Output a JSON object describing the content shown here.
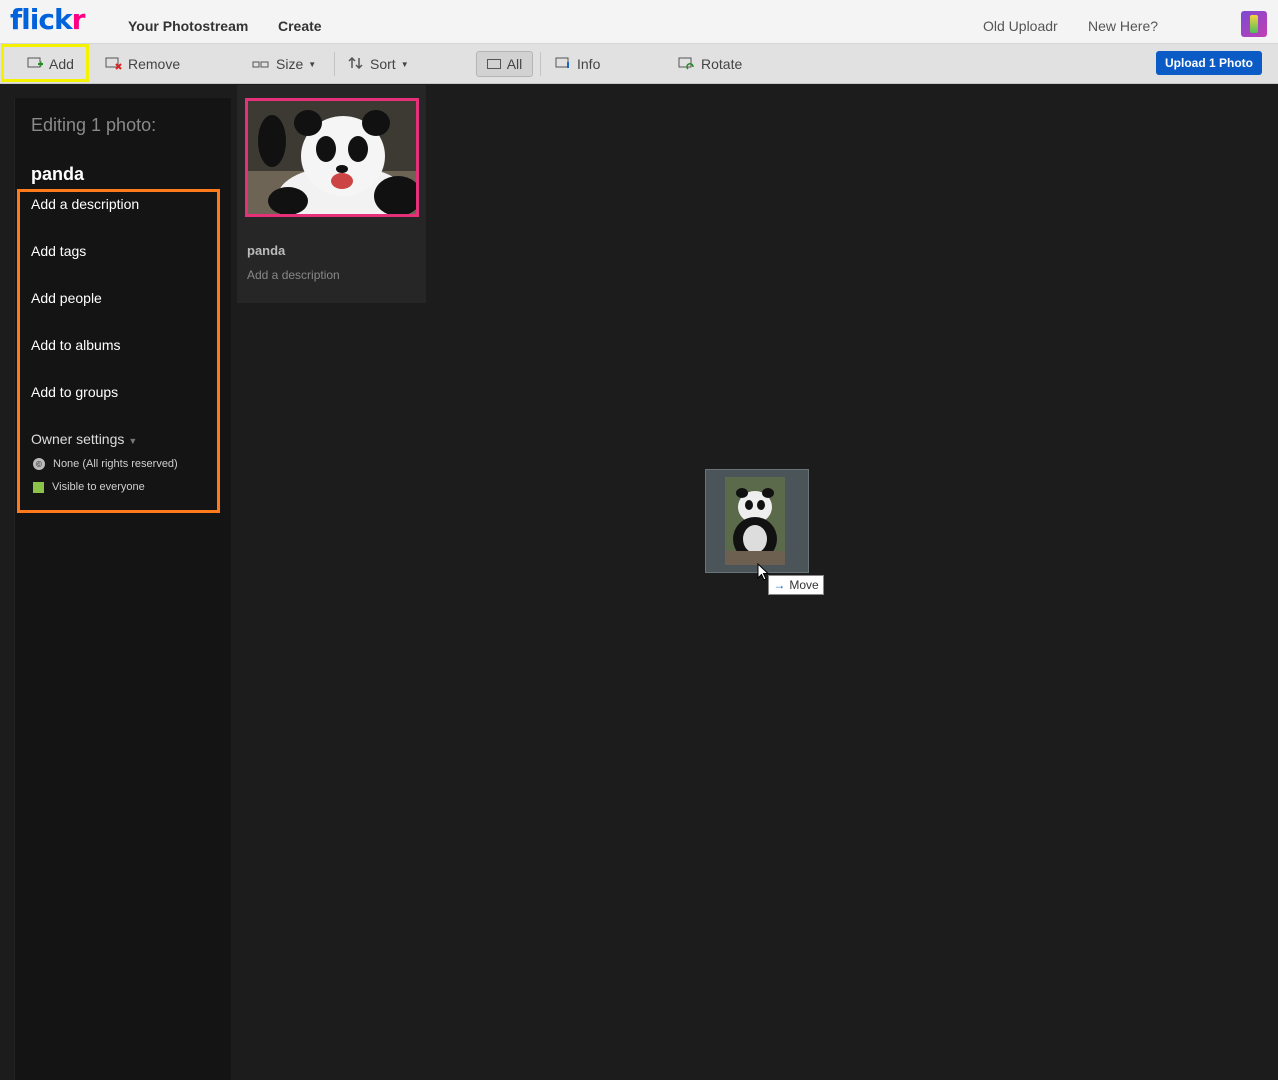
{
  "nav": {
    "logo_main": "flick",
    "logo_accent": "r",
    "photostream": "Your Photostream",
    "create": "Create",
    "old_uploadr": "Old Uploadr",
    "new_here": "New Here?"
  },
  "toolbar": {
    "add": "Add",
    "remove": "Remove",
    "size": "Size",
    "sort": "Sort",
    "all": "All",
    "info": "Info",
    "rotate": "Rotate",
    "upload": "Upload 1 Photo"
  },
  "sidebar": {
    "editing": "Editing 1 photo:",
    "title": "panda",
    "items": [
      "Add a description",
      "Add tags",
      "Add people",
      "Add to albums",
      "Add to groups"
    ],
    "owner_settings": "Owner settings",
    "license": "None (All rights reserved)",
    "visibility": "Visible to everyone"
  },
  "photo": {
    "title": "panda",
    "description": "Add a description"
  },
  "drag": {
    "tooltip": "Move"
  },
  "colors": {
    "flickr_blue": "#0063dc",
    "flickr_pink": "#ff0084",
    "add_highlight": "#f5f200",
    "sidebar_highlight": "#ff7a1a",
    "selected_border": "#e6317a",
    "upload_button": "#0a5bc5"
  }
}
